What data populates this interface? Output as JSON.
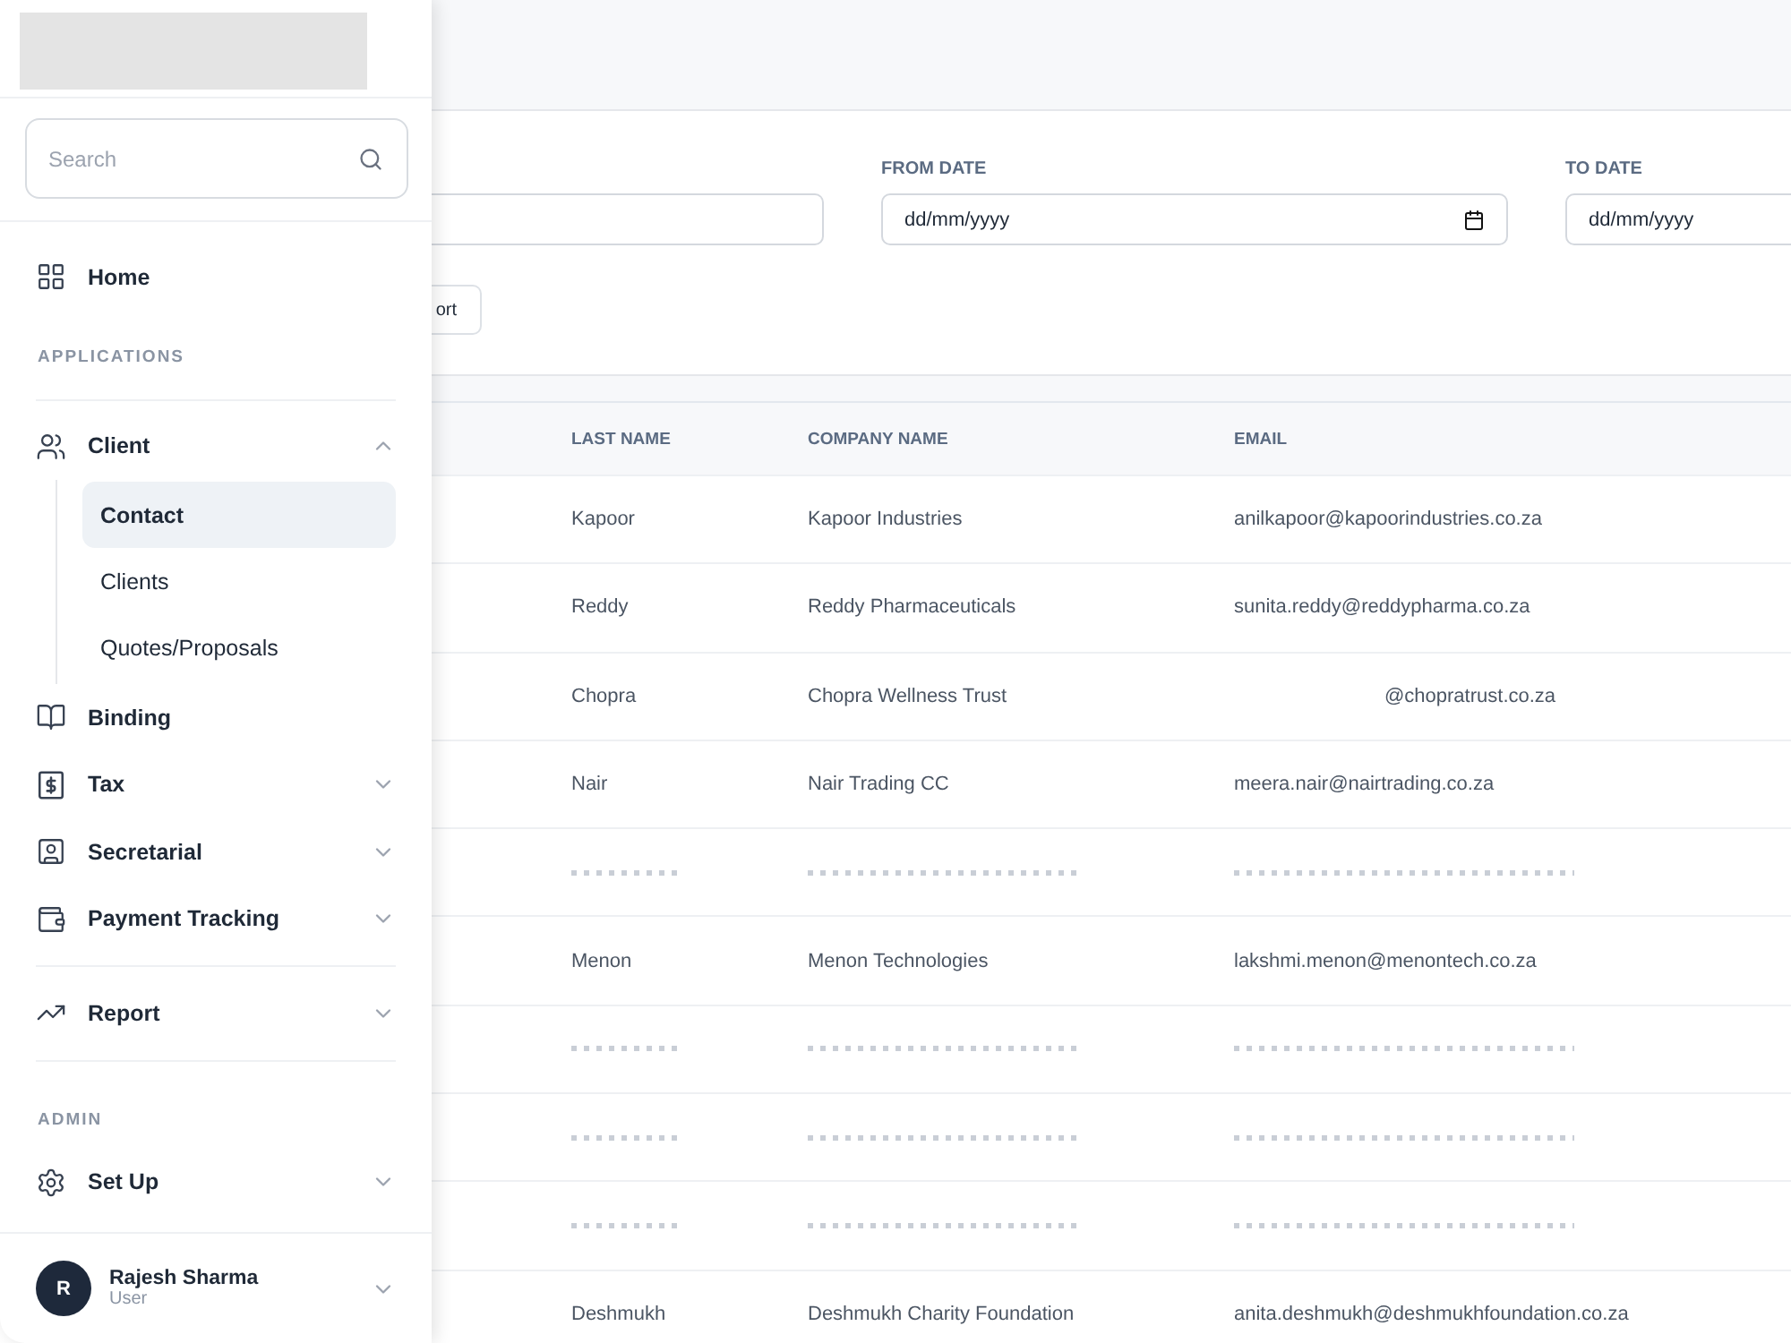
{
  "sidebar": {
    "search": {
      "placeholder": "Search"
    },
    "nav": [
      {
        "kind": "item",
        "label": "Home"
      },
      {
        "kind": "heading",
        "label": "APPLICATIONS"
      },
      {
        "kind": "divider"
      },
      {
        "kind": "group",
        "label": "Client",
        "expanded": true,
        "children": [
          {
            "label": "Contact",
            "selected": true
          },
          {
            "label": "Clients",
            "selected": false
          },
          {
            "label": "Quotes/Proposals",
            "selected": false
          }
        ]
      },
      {
        "kind": "item",
        "label": "Binding"
      },
      {
        "kind": "group",
        "label": "Tax",
        "expanded": false
      },
      {
        "kind": "group",
        "label": "Secretarial",
        "expanded": false
      },
      {
        "kind": "group",
        "label": "Payment Tracking",
        "expanded": false
      },
      {
        "kind": "divider"
      },
      {
        "kind": "group",
        "label": "Report",
        "expanded": false
      },
      {
        "kind": "divider"
      },
      {
        "kind": "heading",
        "label": "ADMIN"
      },
      {
        "kind": "group",
        "label": "Set Up",
        "expanded": false
      }
    ],
    "user": {
      "initial": "R",
      "name": "Rajesh Sharma",
      "role": "User"
    }
  },
  "filters": [
    {
      "kind": "text"
    },
    {
      "kind": "date",
      "label": "FROM DATE",
      "value": "dd/mm/yyyy"
    },
    {
      "kind": "date",
      "label": "TO DATE",
      "value": "dd/mm/yyyy"
    }
  ],
  "actions": [
    {
      "label": "ort"
    }
  ],
  "table": {
    "columns": [
      "LAST NAME",
      "COMPANY NAME",
      "EMAIL"
    ],
    "rows": [
      {
        "kind": "text",
        "cells": [
          "Kapoor",
          "Kapoor Industries",
          "anilkapoor@kapoorindustries.co.za"
        ]
      },
      {
        "kind": "text",
        "cells": [
          "Reddy",
          "Reddy Pharmaceuticals",
          "sunita.reddy@reddypharma.co.za"
        ]
      },
      {
        "kind": "text",
        "cells": [
          "Chopra",
          "Chopra Wellness Trust",
          "@chopratrust.co.za"
        ]
      },
      {
        "kind": "text",
        "cells": [
          "Nair",
          "Nair Trading CC",
          "meera.nair@nairtrading.co.za"
        ]
      },
      {
        "kind": "blurred"
      },
      {
        "kind": "text",
        "cells": [
          "Menon",
          "Menon Technologies",
          "lakshmi.menon@menontech.co.za"
        ]
      },
      {
        "kind": "blurred"
      },
      {
        "kind": "blurred"
      },
      {
        "kind": "blurred"
      },
      {
        "kind": "text",
        "cells": [
          "Deshmukh",
          "Deshmukh Charity Foundation",
          "anita.deshmukh@deshmukhfoundation.co.za"
        ]
      }
    ]
  }
}
